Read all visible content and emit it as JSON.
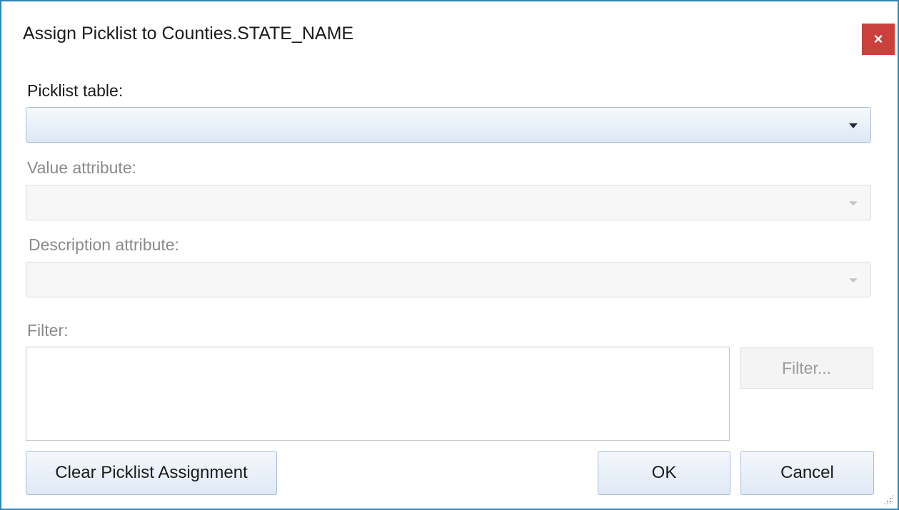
{
  "dialog": {
    "title": "Assign Picklist to Counties.STATE_NAME",
    "close_label": "×"
  },
  "picklist_table": {
    "label": "Picklist table:",
    "value": ""
  },
  "value_attribute": {
    "label": "Value attribute:",
    "value": ""
  },
  "description_attribute": {
    "label": "Description attribute:",
    "value": ""
  },
  "filter": {
    "label": "Filter:",
    "value": "",
    "button_label": "Filter..."
  },
  "buttons": {
    "clear_label": "Clear Picklist Assignment",
    "ok_label": "OK",
    "cancel_label": "Cancel"
  },
  "colors": {
    "accent_border": "#2b86b8",
    "close_button": "#c9403c",
    "disabled_text": "#8a8a8a"
  }
}
